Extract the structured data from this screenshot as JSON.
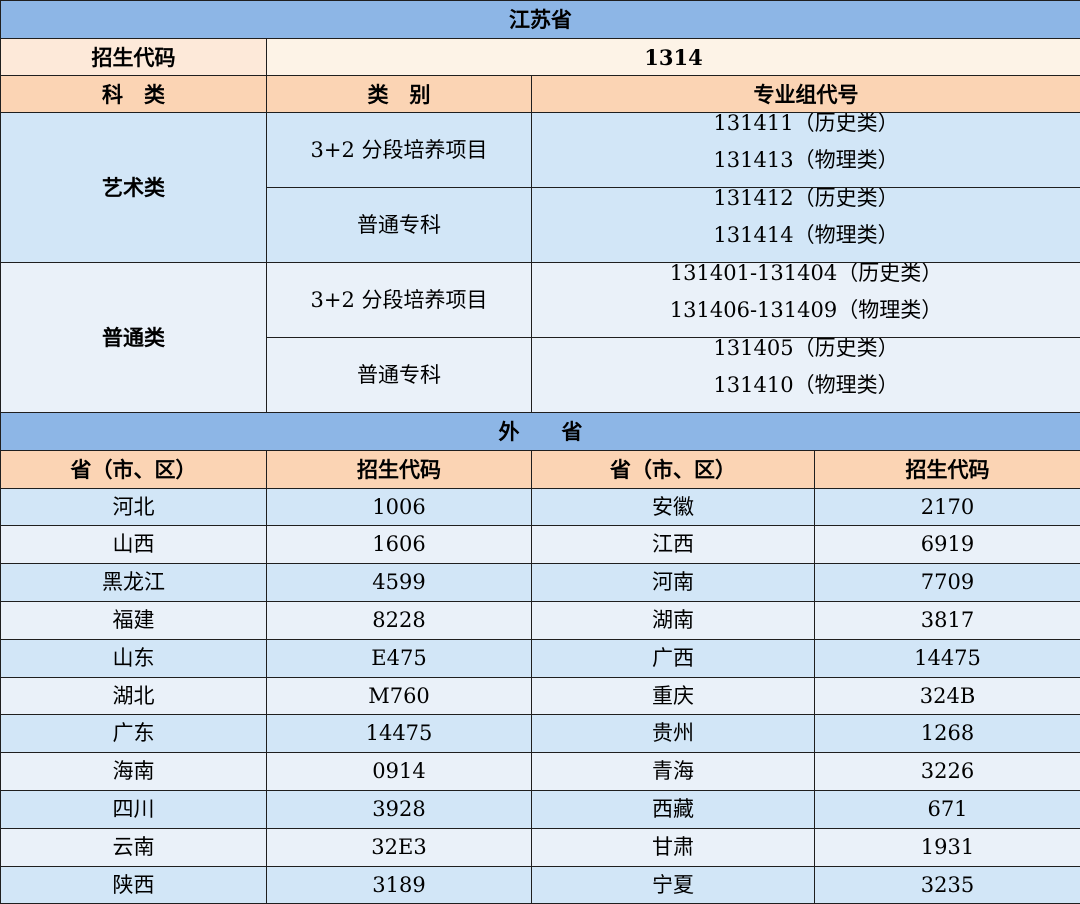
{
  "jiangsu": {
    "title": "江苏省",
    "code_label": "招生代码",
    "code_value": "1314",
    "headers": [
      "科　类",
      "类　别",
      "专业组代号"
    ],
    "groups": [
      {
        "category": "艺术类",
        "rows": [
          {
            "type": "3+2 分段培养项目",
            "codes": [
              "131411（历史类）",
              "131413（物理类）"
            ]
          },
          {
            "type": "普通专科",
            "codes": [
              "131412（历史类）",
              "131414（物理类）"
            ]
          }
        ]
      },
      {
        "category": "普通类",
        "rows": [
          {
            "type": "3+2 分段培养项目",
            "codes": [
              "131401-131404（历史类）",
              "131406-131409（物理类）"
            ]
          },
          {
            "type": "普通专科",
            "codes": [
              "131405（历史类）",
              "131410（物理类）"
            ]
          }
        ]
      }
    ]
  },
  "other_provinces": {
    "title": "外　　省",
    "headers": [
      "省（市、区）",
      "招生代码",
      "省（市、区）",
      "招生代码"
    ],
    "rows": [
      [
        "河北",
        "1006",
        "安徽",
        "2170"
      ],
      [
        "山西",
        "1606",
        "江西",
        "6919"
      ],
      [
        "黑龙江",
        "4599",
        "河南",
        "7709"
      ],
      [
        "福建",
        "8228",
        "湖南",
        "3817"
      ],
      [
        "山东",
        "E475",
        "广西",
        "14475"
      ],
      [
        "湖北",
        "M760",
        "重庆",
        "324B"
      ],
      [
        "广东",
        "14475",
        "贵州",
        "1268"
      ],
      [
        "海南",
        "0914",
        "青海",
        "3226"
      ],
      [
        "四川",
        "3928",
        "西藏",
        "671"
      ],
      [
        "云南",
        "32E3",
        "甘肃",
        "1931"
      ],
      [
        "陕西",
        "3189",
        "宁夏",
        "3235"
      ]
    ]
  }
}
